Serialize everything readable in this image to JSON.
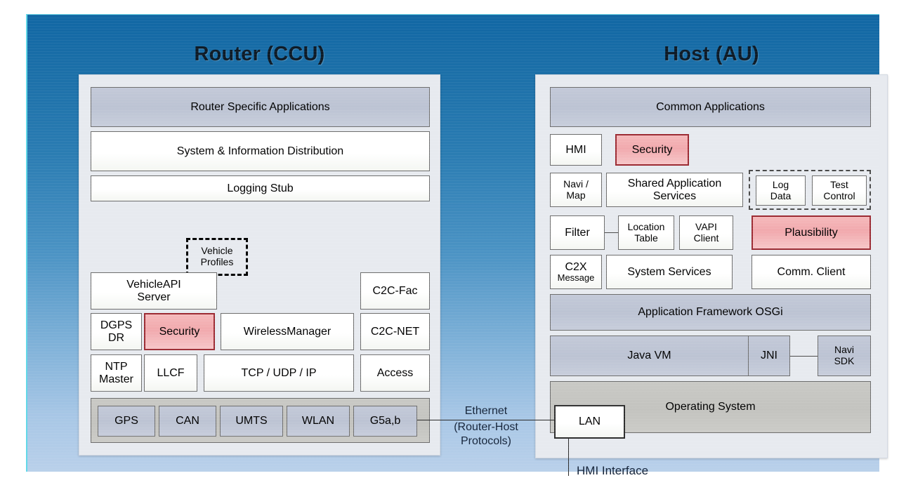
{
  "diagram": {
    "title_router": "Router (CCU)",
    "title_host": "Host (AU)"
  },
  "router": {
    "layers": {
      "apps": "Router Specific Applications",
      "sysinfo": "System & Information Distribution",
      "logging": "Logging Stub"
    },
    "blocks": {
      "vehicle_profiles": "Vehicle\nProfiles",
      "vehicleapi_server": "VehicleAPI\nServer",
      "c2c_fac": "C2C-Fac",
      "dgps_dr": "DGPS\nDR",
      "security": "Security",
      "wireless_manager": "WirelessManager",
      "c2c_net": "C2C-NET",
      "ntp_master": "NTP\nMaster",
      "llcf": "LLCF",
      "tcp_udp_ip": "TCP / UDP / IP",
      "access": "Access"
    },
    "hardware": {
      "gps": "GPS",
      "can": "CAN",
      "umts": "UMTS",
      "wlan": "WLAN",
      "g5ab": "G5a,b"
    }
  },
  "host": {
    "layers": {
      "common_apps": "Common Applications",
      "app_framework": "Application Framework OSGi",
      "operating_system": "Operating System"
    },
    "blocks": {
      "hmi": "HMI",
      "security": "Security",
      "navi_map": "Navi /\nMap",
      "shared_app_services": "Shared Application\nServices",
      "log_data": "Log\nData",
      "test_control": "Test\nControl",
      "filter": "Filter",
      "location_table": "Location\nTable",
      "vapi_client": "VAPI\nClient",
      "plausibility": "Plausibility",
      "c2x_message_line1": "C2X",
      "c2x_message_line2": "Message",
      "system_services": "System Services",
      "comm_client": "Comm. Client",
      "java_vm": "Java VM",
      "jni": "JNI",
      "navi_sdk": "Navi\nSDK",
      "lan": "LAN"
    }
  },
  "connectors": {
    "ethernet_line1": "Ethernet",
    "ethernet_line2": "(Router-Host\nProtocols)",
    "hmi_interface": "HMI Interface"
  },
  "colors": {
    "highlight_red_fill": "#f1a9ad",
    "highlight_red_border": "#9c2b33",
    "layer_gray_blue": "#c3c9d8",
    "os_gray": "#c9c9c5",
    "panel_bg": "#e7eaef",
    "canvas_blue_top": "#1167a4",
    "canvas_blue_bottom": "#b9d0ea"
  }
}
